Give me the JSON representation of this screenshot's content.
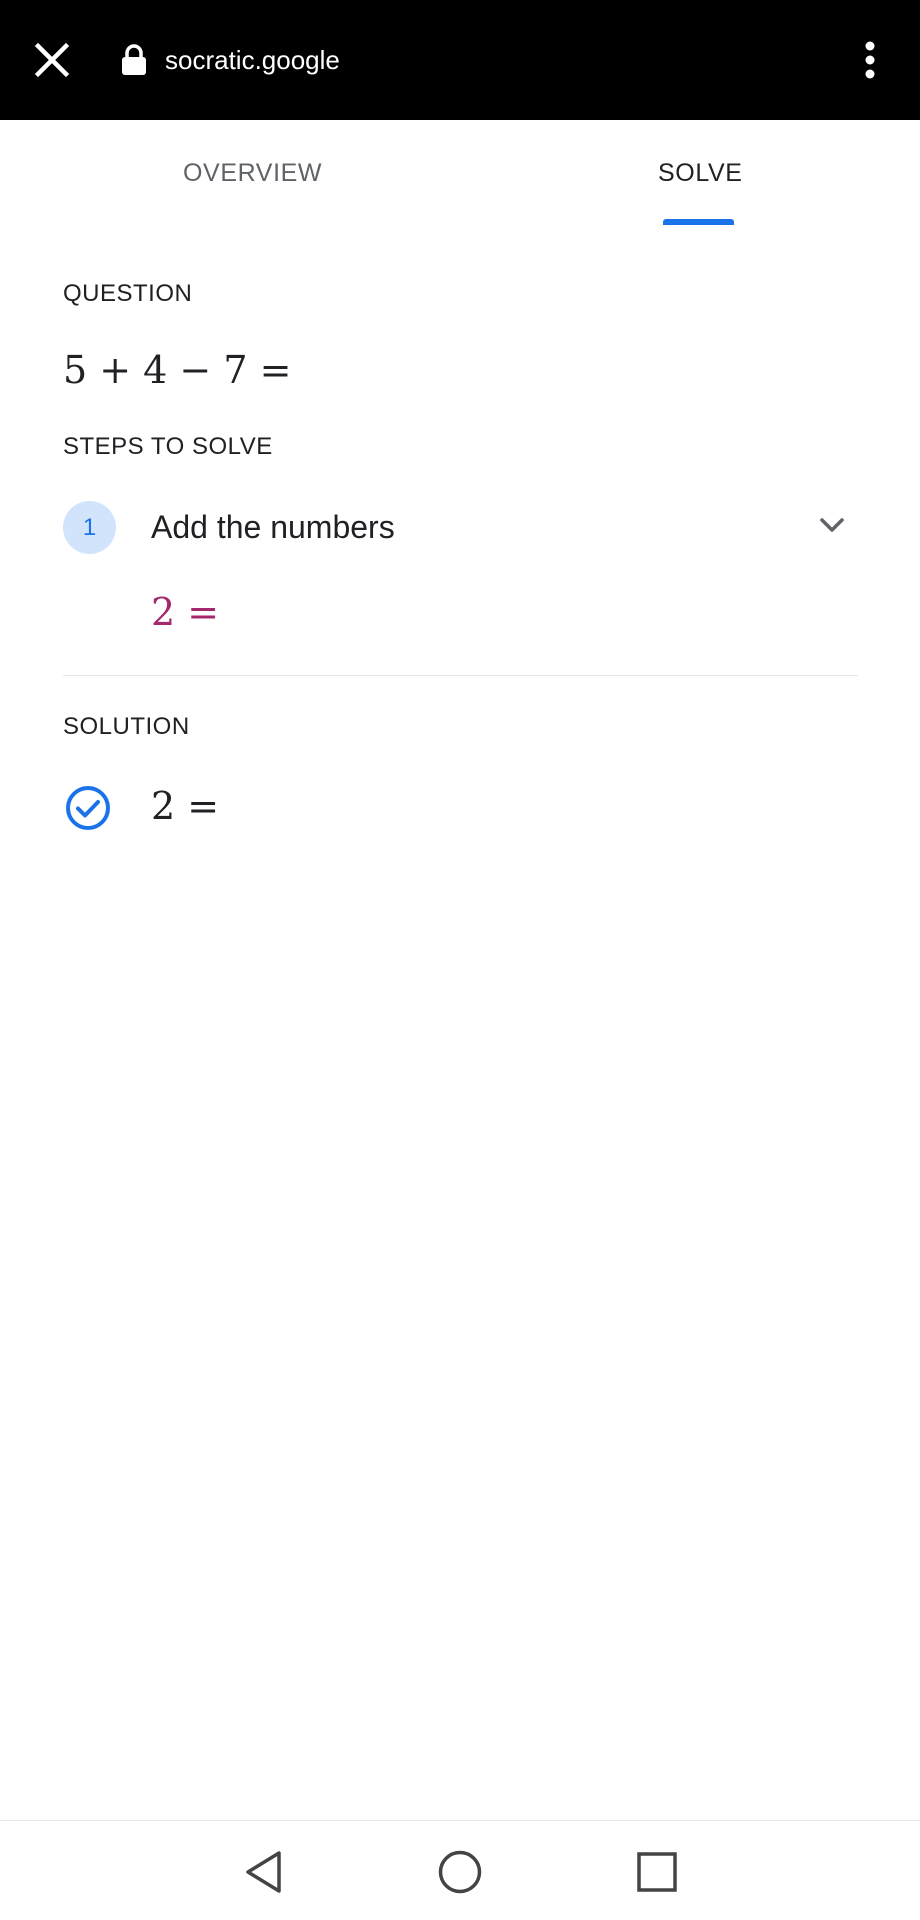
{
  "browser": {
    "url": "socratic.google",
    "close_icon": "close-icon",
    "lock_icon": "lock-icon",
    "menu_icon": "more-vert-icon"
  },
  "tabs": [
    {
      "label": "OVERVIEW",
      "active": false
    },
    {
      "label": "SOLVE",
      "active": true
    }
  ],
  "question": {
    "label": "QUESTION",
    "expression": "5 + 4 − 7 ="
  },
  "steps": {
    "label": "STEPS TO SOLVE",
    "items": [
      {
        "number": "1",
        "title": "Add the numbers",
        "result": "2 ="
      }
    ]
  },
  "solution": {
    "label": "SOLUTION",
    "result": "2 ="
  },
  "colors": {
    "accent": "#1a73e8",
    "step_badge_bg": "#d2e3fc",
    "step_result": "#a3286e"
  },
  "navbar": {
    "back_icon": "back-triangle-icon",
    "home_icon": "home-circle-icon",
    "recents_icon": "recents-square-icon"
  }
}
